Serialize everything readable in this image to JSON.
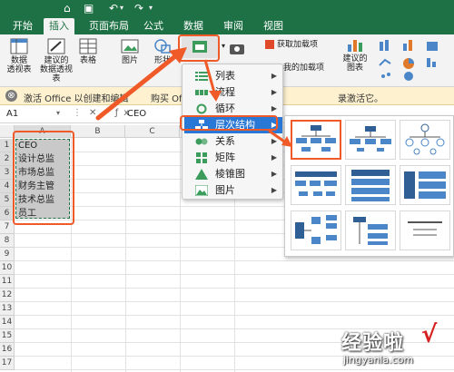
{
  "tabs": [
    "开始",
    "插入",
    "页面布局",
    "公式",
    "数据",
    "审阅",
    "视图"
  ],
  "ribbon": {
    "pivot_label": "数据\n透视表",
    "recommended_pivot_label": "建议的\n数据透视表",
    "table_label": "表格",
    "pictures_label": "图片",
    "shapes_label": "形状",
    "get_addins_label": "获取加载项",
    "my_addins_label": "我的加载项",
    "recommended_charts_label": "建议的\n图表"
  },
  "infobar": {
    "text": "激活 Office 以创建和编辑",
    "text_right": "录激活它。",
    "hidden_fragment": "购买 Office, 如果"
  },
  "formula": {
    "namebox": "A1",
    "value": "CEO"
  },
  "columns": [
    "A",
    "B",
    "C"
  ],
  "rows": [
    "1",
    "2",
    "3",
    "4",
    "5",
    "6",
    "7",
    "8",
    "9",
    "10",
    "11",
    "12",
    "13",
    "14",
    "15",
    "16",
    "17"
  ],
  "cells": [
    "CEO",
    "设计总监",
    "市场总监",
    "财务主管",
    "技术总监",
    "员工"
  ],
  "menu": {
    "items": [
      {
        "label": "列表",
        "icon": "list-icon"
      },
      {
        "label": "流程",
        "icon": "process-icon"
      },
      {
        "label": "循环",
        "icon": "cycle-icon"
      },
      {
        "label": "层次结构",
        "icon": "hierarchy-icon"
      },
      {
        "label": "关系",
        "icon": "relationship-icon"
      },
      {
        "label": "矩阵",
        "icon": "matrix-icon"
      },
      {
        "label": "棱锥图",
        "icon": "pyramid-icon"
      },
      {
        "label": "图片",
        "icon": "picture-icon"
      }
    ],
    "highlighted_index": 3
  },
  "watermark": {
    "main": "经验啦",
    "url": "jingyanla.com",
    "check": "√"
  },
  "colors": {
    "brand_green": "#1e7145",
    "highlight_blue": "#2a78d6",
    "annotation_red": "#f05a28"
  }
}
